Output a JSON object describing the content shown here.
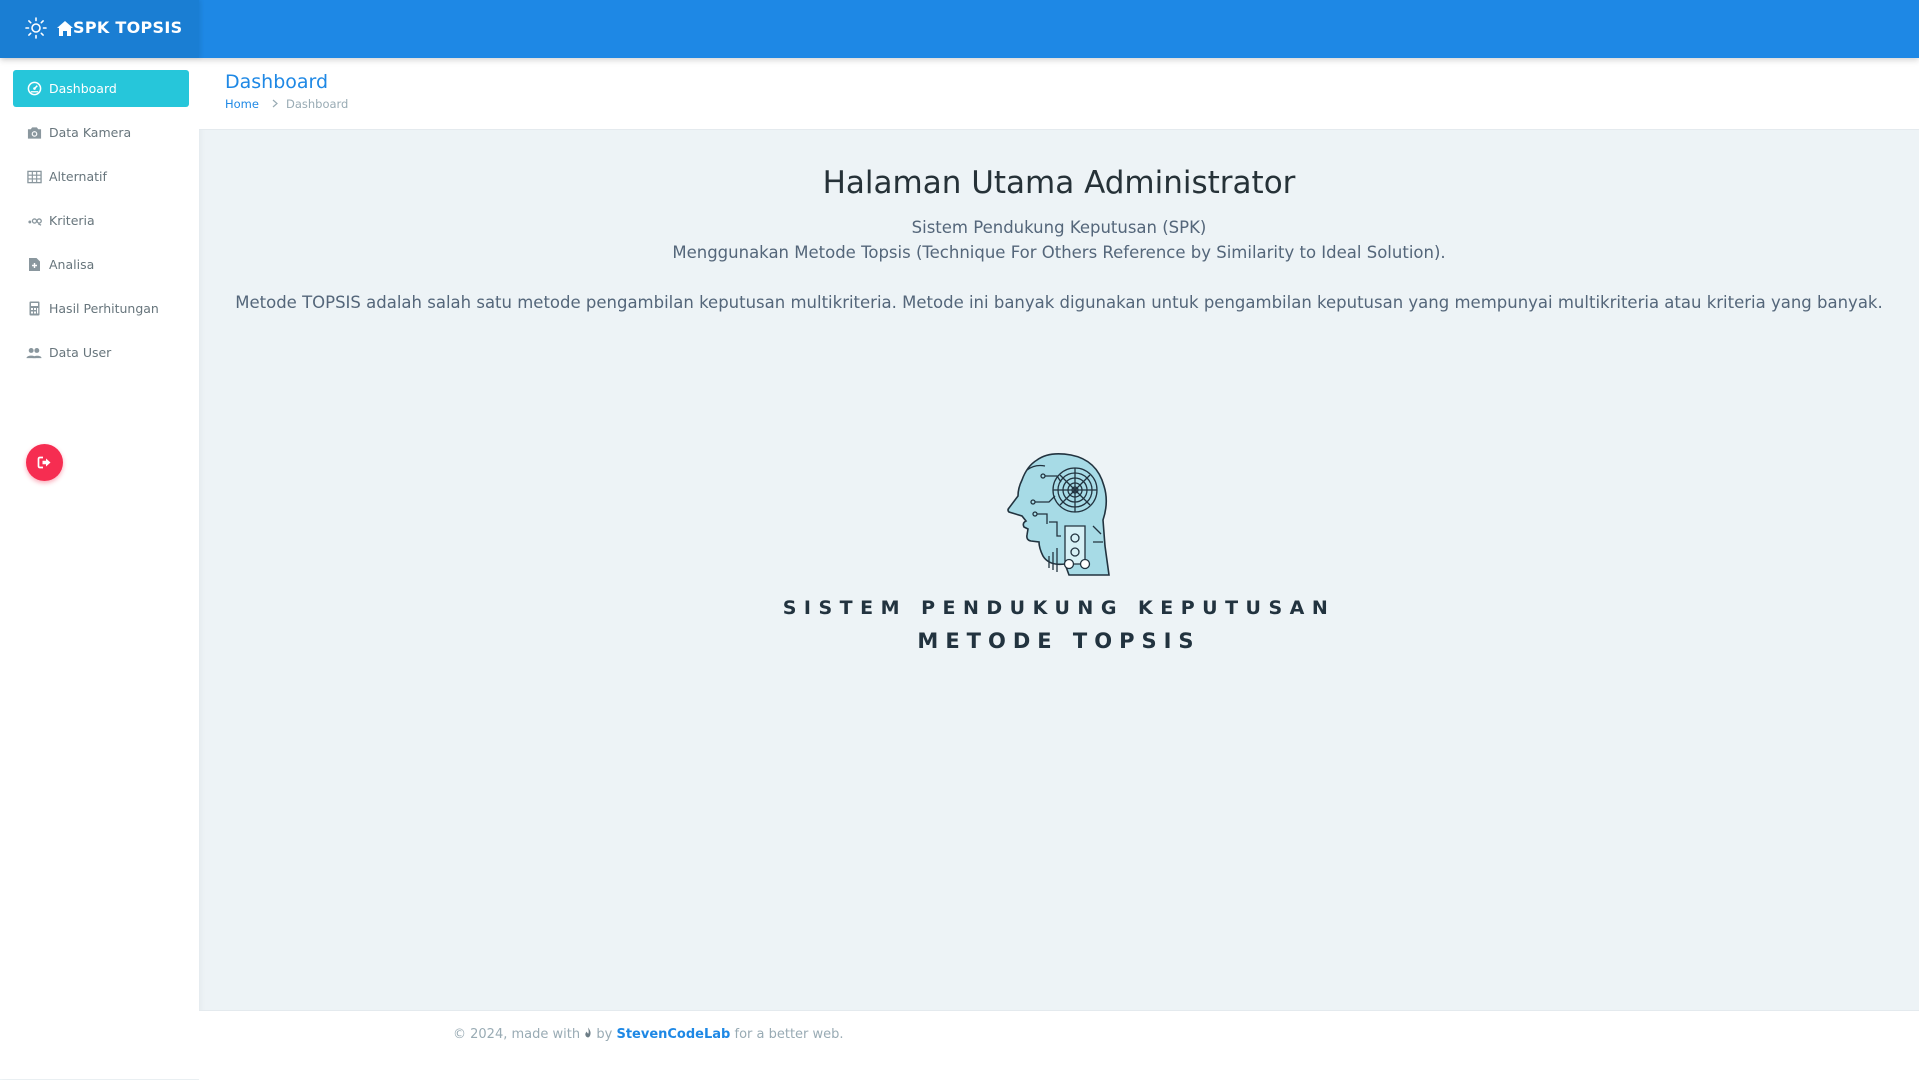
{
  "brand": {
    "title": "SPK TOPSIS",
    "icons": [
      "sun-icon",
      "home-icon"
    ]
  },
  "sidebar": {
    "items": [
      {
        "label": "Dashboard",
        "icon": "dashboard-icon",
        "active": true
      },
      {
        "label": "Data Kamera",
        "icon": "camera-icon"
      },
      {
        "label": "Alternatif",
        "icon": "table-icon"
      },
      {
        "label": "Kriteria",
        "icon": "criteria-icon"
      },
      {
        "label": "Analisa",
        "icon": "document-add-icon"
      },
      {
        "label": "Hasil Perhitungan",
        "icon": "calculator-icon"
      },
      {
        "label": "Data User",
        "icon": "users-icon"
      }
    ],
    "logout_icon": "logout-icon"
  },
  "page": {
    "title": "Dashboard",
    "breadcrumb": {
      "home": "Home",
      "current": "Dashboard"
    }
  },
  "main": {
    "heading": "Halaman Utama Administrator",
    "subtitle1": "Sistem Pendukung Keputusan (SPK)",
    "subtitle2": "Menggunakan Metode Topsis (Technique For Others Reference by Similarity to Ideal Solution).",
    "description": "Metode TOPSIS adalah salah satu metode pengambilan keputusan multikriteria. Metode ini banyak digunakan untuk pengambilan keputusan yang mempunyai multikriteria atau kriteria yang banyak.",
    "logo": {
      "line1": "SISTEM PENDUKUNG KEPUTUSAN",
      "line2": "METODE TOPSIS"
    }
  },
  "footer": {
    "prefix": "© 2024, made with",
    "by": "by",
    "author": "StevenCodeLab",
    "suffix": "for a better web."
  },
  "colors": {
    "topbar": "#1e88e5",
    "active_item": "#26c6da",
    "logout": "#f62d51",
    "content_bg": "#edf3f6"
  }
}
